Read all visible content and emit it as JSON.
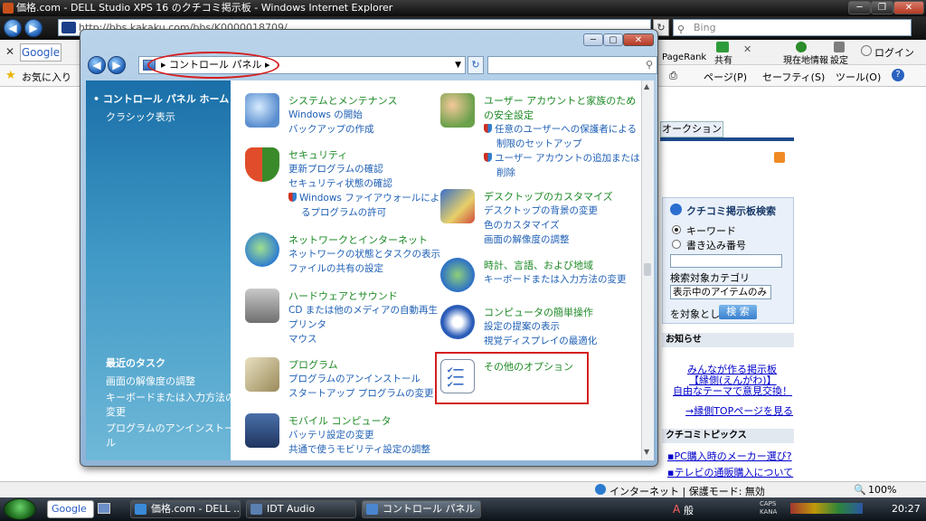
{
  "ie": {
    "title": "価格.com - DELL Studio XPS 16 のクチコミ掲示板 - Windows Internet Explorer",
    "url": "http://bbs.kakaku.com/bbs/K0000018709/",
    "search_placeholder": "Bing",
    "google_label": "Google",
    "favorites_label": "お気に入り",
    "toolbar": {
      "pagerank": "PageRank",
      "share": "共有",
      "location": "現在地情報",
      "settings": "設定",
      "login": "ログイン",
      "page_menu": "ページ(P)",
      "safety_menu": "セーフティ(S)",
      "tools_menu": "ツール(O)"
    },
    "status": {
      "zone": "インターネット | 保護モード: 無効",
      "zoom": "100%"
    }
  },
  "page": {
    "auction_tab": "オークション",
    "search_box": {
      "title": "クチコミ掲示板検索",
      "opt_keyword": "キーワード",
      "opt_number": "書き込み番号",
      "category_label": "検索対象カテゴリ",
      "category_value": "表示中のアイテムのみ",
      "target_suffix": "を対象として",
      "search_button": "検 索"
    },
    "notice": {
      "heading": "お知らせ",
      "line1": "みんなが作る掲示板",
      "line2": "【縁側(えんがわ)】",
      "line3": "自由なテーマで意見交換！",
      "link": "→縁側TOPページを見る"
    },
    "topics": {
      "heading": "クチコミトピックス",
      "items": [
        "PC購入時のメーカー選び?",
        "テレビの通販購入について"
      ]
    }
  },
  "cp": {
    "breadcrumb": "コントロール パネル",
    "sidebar": {
      "home": "コントロール パネル ホーム",
      "classic": "クラシック表示",
      "recent_heading": "最近のタスク",
      "recent": [
        "画面の解像度の調整",
        "キーボードまたは入力方法の",
        "変更",
        "プログラムのアンインストー",
        "ル"
      ]
    },
    "left_categories": [
      {
        "title": "システムとメンテナンス",
        "links": [
          "Windows の開始",
          "バックアップの作成"
        ]
      },
      {
        "title": "セキュリティ",
        "links": [
          "更新プログラムの確認",
          "セキュリティ状態の確認",
          "Windows ファイアウォールによ",
          "るプログラムの許可"
        ]
      },
      {
        "title": "ネットワークとインターネット",
        "links": [
          "ネットワークの状態とタスクの表示",
          "ファイルの共有の設定"
        ]
      },
      {
        "title": "ハードウェアとサウンド",
        "links": [
          "CD または他のメディアの自動再生",
          "プリンタ",
          "マウス"
        ]
      },
      {
        "title": "プログラム",
        "links": [
          "プログラムのアンインストール",
          "スタートアップ プログラムの変更"
        ]
      },
      {
        "title": "モバイル コンピュータ",
        "links": [
          "バッテリ設定の変更",
          "共通で使うモビリティ設定の調整"
        ]
      }
    ],
    "right_categories": [
      {
        "title": "ユーザー アカウントと家族のため",
        "title2": "の安全設定",
        "links": [
          "任意のユーザーへの保護者による",
          "制限のセットアップ",
          "ユーザー アカウントの追加または",
          "削除"
        ]
      },
      {
        "title": "デスクトップのカスタマイズ",
        "links": [
          "デスクトップの背景の変更",
          "色のカスタマイズ",
          "画面の解像度の調整"
        ]
      },
      {
        "title": "時計、言語、および地域",
        "links": [
          "キーボードまたは入力方法の変更"
        ]
      },
      {
        "title": "コンピュータの簡単操作",
        "links": [
          "設定の提案の表示",
          "視覚ディスプレイの最適化"
        ]
      },
      {
        "title": "その他のオプション",
        "links": []
      }
    ]
  },
  "taskbar": {
    "google": "Google",
    "tasks": [
      "価格.com - DELL ...",
      "IDT Audio",
      "コントロール パネル"
    ],
    "tray_text": "A 般",
    "caps": "CAPS",
    "kana": "KANA",
    "clock": "20:27"
  },
  "colors": {
    "annotation_red": "#d41f1f",
    "link_blue": "#1e5fb5",
    "category_green": "#1e8a26",
    "sidebar_blue": "#1a6fa8"
  }
}
